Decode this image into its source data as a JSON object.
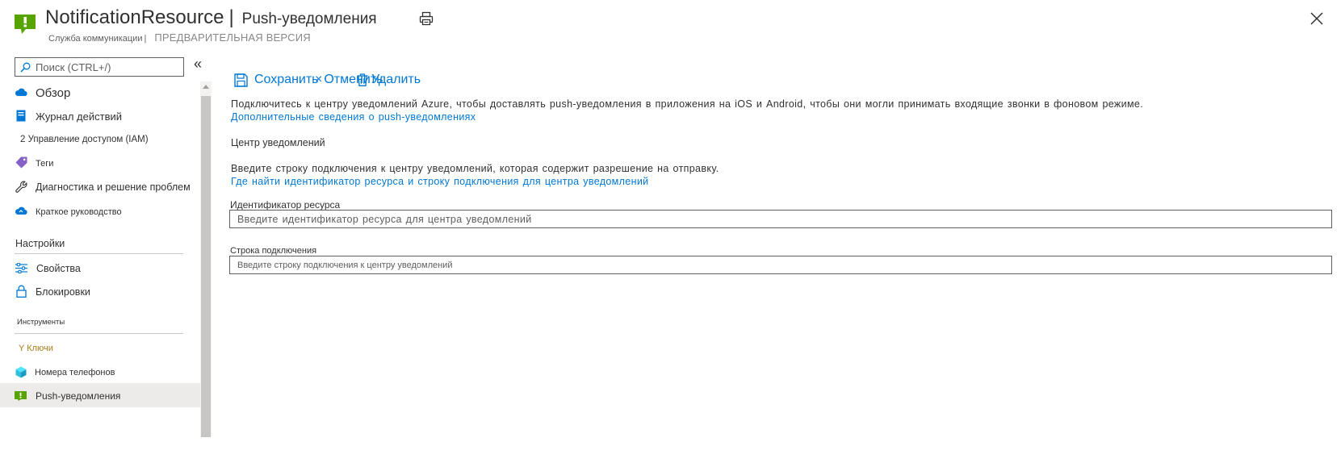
{
  "header": {
    "resource_name": "NotificationResource",
    "separator": "|",
    "blade_name": "Push-уведомления",
    "service_type": "Служба коммуникации",
    "subtitle_separator": "|",
    "preview_badge": "ПРЕДВАРИТЕЛЬНАЯ ВЕРСИЯ",
    "icons": {
      "resource": "notification-hub-icon",
      "print": "print-icon",
      "close": "close-icon"
    }
  },
  "sidebar": {
    "search": {
      "placeholder": "Поиск (CTRL+/)",
      "value": ""
    },
    "collapse_label": "«",
    "items": [
      {
        "label": "Обзор",
        "icon": "cloud-icon"
      },
      {
        "label": "Журнал действий",
        "icon": "activity-log-icon"
      },
      {
        "label": "2 Управление доступом (IAM)",
        "icon": ""
      },
      {
        "label": "Теги",
        "icon": "tag-icon"
      },
      {
        "label": "Диагностика и решение проблем",
        "icon": "wrench-icon"
      },
      {
        "label": "Краткое руководство",
        "icon": "cloud-quickstart-icon"
      }
    ],
    "settings": {
      "header": "Настройки",
      "items": [
        {
          "label": "Свойства",
          "icon": "properties-icon"
        },
        {
          "label": "Блокировки",
          "icon": "lock-icon"
        }
      ]
    },
    "tools": {
      "header": "Инструменты",
      "items": [
        {
          "label": "Y Ключи",
          "icon": ""
        },
        {
          "label": "Номера телефонов",
          "icon": "cube-icon"
        },
        {
          "label": "Push-уведомления",
          "icon": "notification-hub-icon",
          "active": true
        }
      ]
    }
  },
  "toolbar": {
    "save_label": "Сохранить",
    "discard_x": "×",
    "discard_label": "Отменить",
    "delete_label": "Удалить"
  },
  "main": {
    "intro_text": "Подключитесь к центру уведомлений Azure, чтобы доставлять push-уведомления в приложения на iOS и Android, чтобы они могли принимать входящие звонки в фоновом режиме.",
    "intro_link": "Дополнительные сведения о push-уведомлениях",
    "hub_heading": "Центр уведомлений",
    "hub_description": "Введите строку подключения к центру уведомлений, которая содержит разрешение на отправку.",
    "hub_link": "Где найти идентификатор ресурса и строку подключения для центра уведомлений",
    "resource_id": {
      "label": "Идентификатор ресурса",
      "placeholder": "Введите идентификатор ресурса для центра уведомлений",
      "value": ""
    },
    "connection_string": {
      "label": "Строка подключения",
      "placeholder": "Введите строку подключения к центру уведомлений",
      "value": ""
    }
  },
  "colors": {
    "accent": "#0078d4",
    "text": "#323130",
    "muted": "#605e5c",
    "active_bg": "#edebe9",
    "hub_green": "#57a300",
    "keys_gold": "#a67b1b"
  }
}
